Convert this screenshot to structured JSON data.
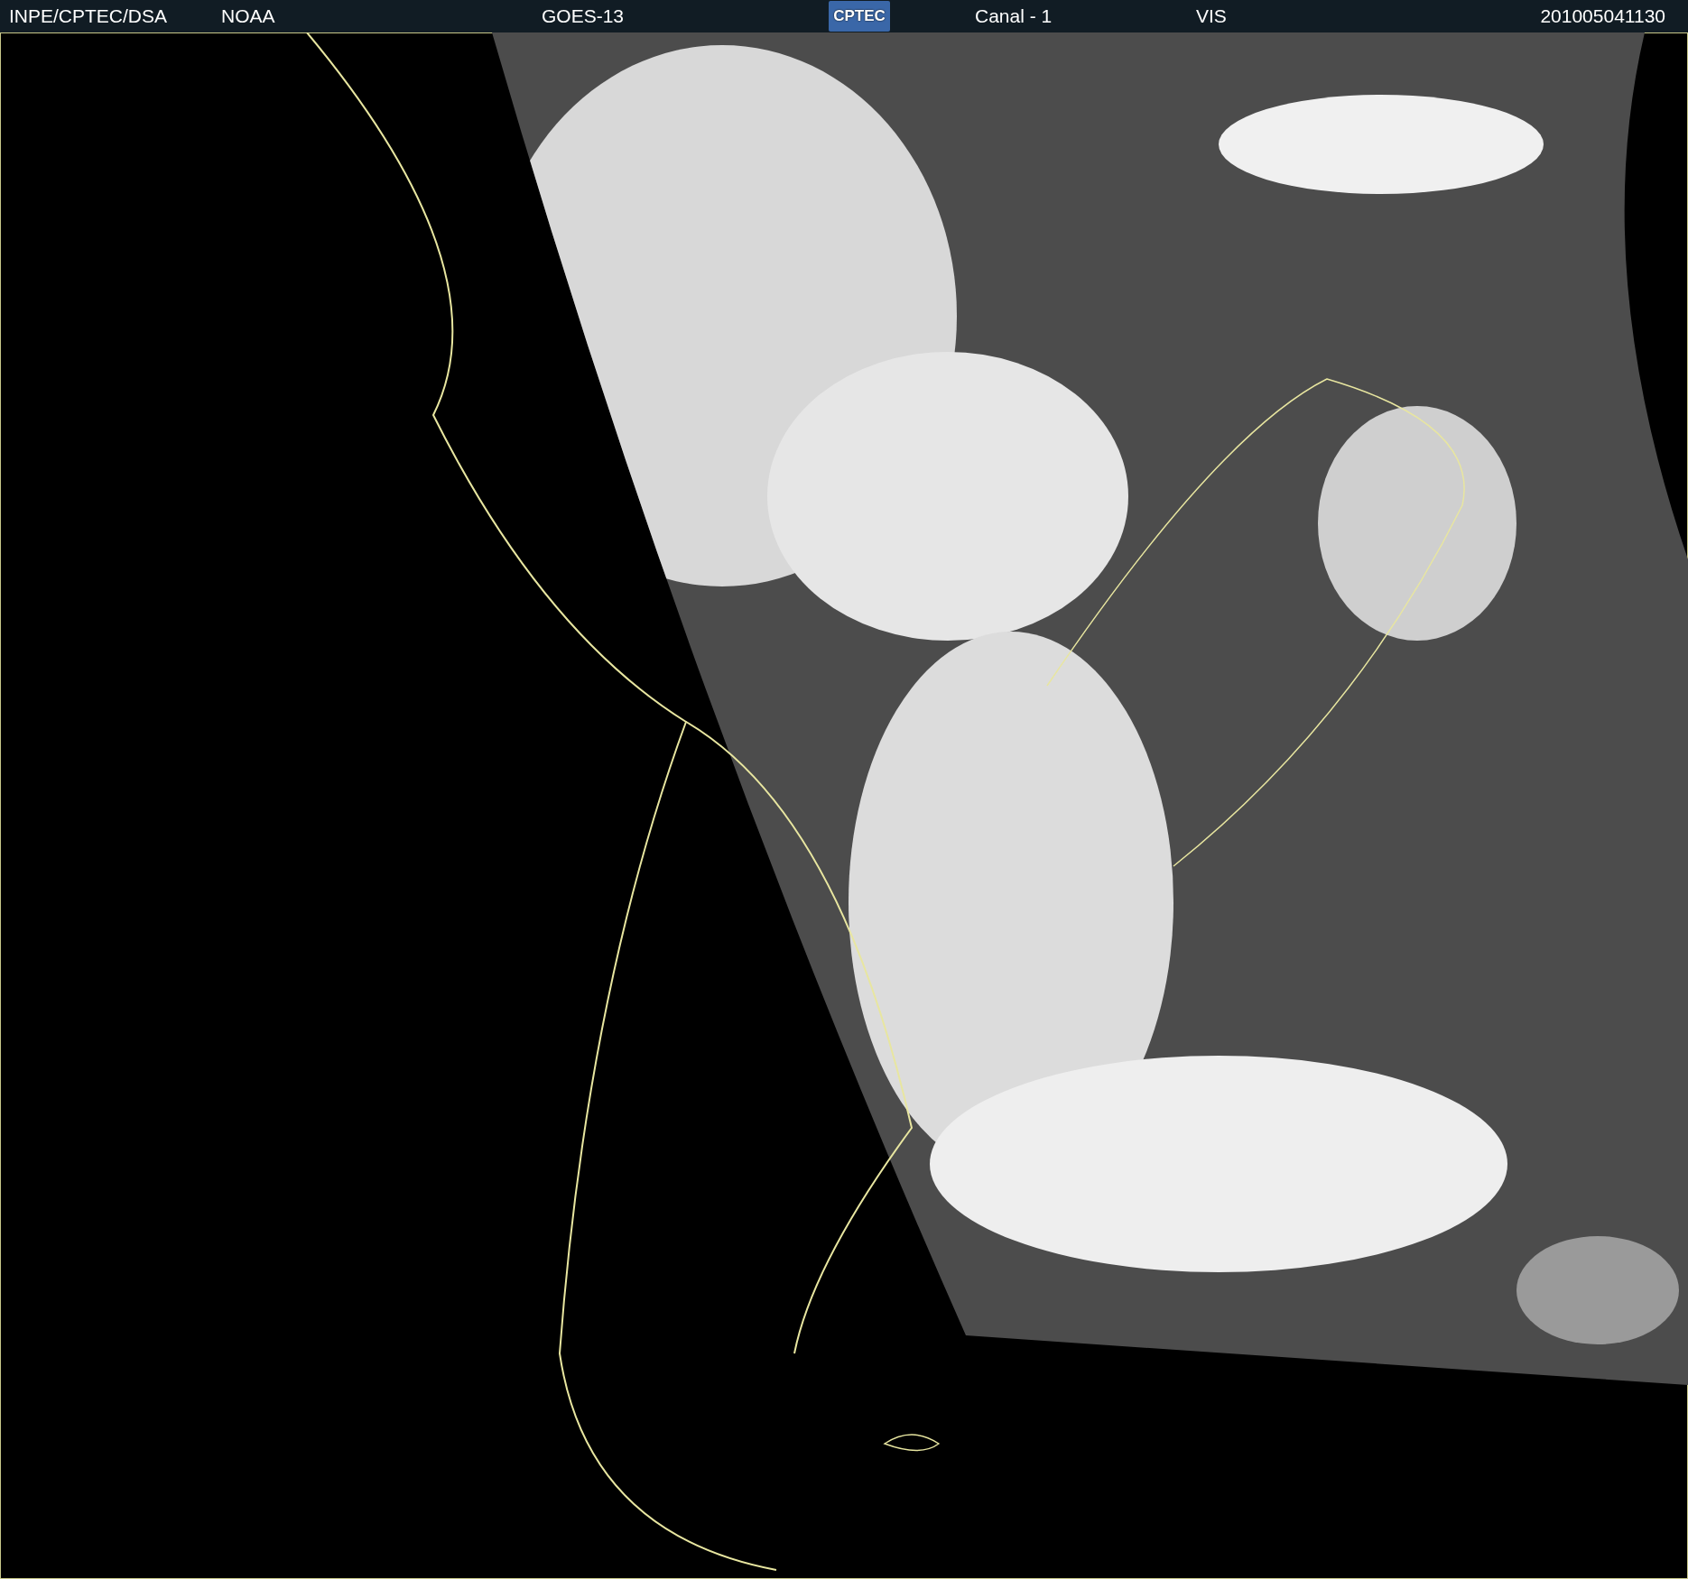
{
  "header": {
    "items": [
      {
        "kind": "text",
        "text": "INPE/CPTEC/DSA"
      },
      {
        "kind": "text",
        "text": "NOAA"
      },
      {
        "kind": "text",
        "text": "GOES-13"
      },
      {
        "kind": "logo",
        "text": "CPTEC"
      },
      {
        "kind": "text",
        "text": "Canal - 1"
      },
      {
        "kind": "text",
        "text": "VIS"
      },
      {
        "kind": "text",
        "text": "201005041130"
      }
    ]
  }
}
